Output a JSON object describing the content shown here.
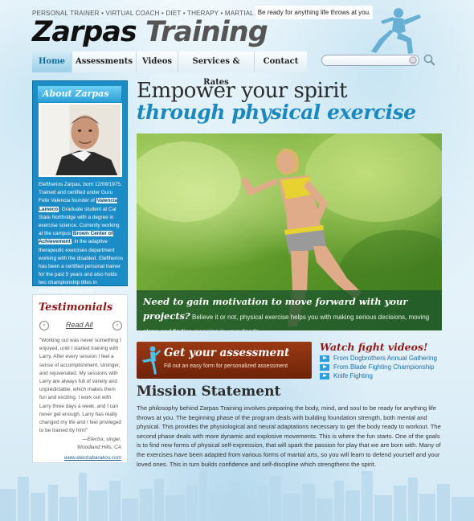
{
  "header": {
    "tagline": "PERSONAL TRAINER  •  VIRTUAL COACH  •  DIET  •  THERAPY  •  MARTIAL ARTS",
    "logo_part1": "Zarpas",
    "logo_part2": "Training",
    "slogan": "Be ready for anything life throws at you."
  },
  "nav": {
    "items": [
      {
        "label": "Home"
      },
      {
        "label": "Assessments"
      },
      {
        "label": "Videos"
      },
      {
        "label": "Services & Rates"
      },
      {
        "label": "Contact"
      }
    ]
  },
  "search": {
    "value": "",
    "clear_glyph": "⊗"
  },
  "about": {
    "title": "About Zarpas",
    "t1": "Eleftherios Zarpas, born 12/09/1975. Trained and certified under Guru Felix Valencia founder of ",
    "link1": "Valencia Lameco",
    "t2": ". Graduate student at Cal State Northridge with a degree in exercise science. Currently working at the campus ",
    "link2": "Brown Center of Achievement",
    "t3": ", in the adaptive therapeutic exercises department working with the disabled. Eleftherios has been a certified personal trainer for the past 5 years and also holds two championship titles in international martial arts tournaments."
  },
  "testimonials": {
    "title": "Testimonials",
    "prev": "‹",
    "next": "›",
    "read_all": "Read All",
    "quote": "\"Working out was never something I enjoyed, until I started training with Larry. After every session I feel a sense of accomplishment, stronger, and rejuvenated. My sessions with Larry are always full of variety and unpredictable, which makes them fun and exciting. I work out with Larry three days a week, and I can never get enough. Larry has really changed my life and I feel privileged to be trained by him!\"",
    "author_line1": "—Electra, singer,",
    "author_line2": "Woodland Hills, CA",
    "link": "www.electrabarakos.com"
  },
  "hero": {
    "headline1": "Empower your spirit",
    "headline2": "through physical exercise",
    "caption_lead": "Need to gain motivation to move forward with your projects?",
    "caption_body": " Believe it or not, physical exercise helps you with making serious decisions, moving along and finding meaning in your deeds."
  },
  "assessment": {
    "title": "Get your assessment",
    "subtitle": "Fill out an easy form for personalized assessment"
  },
  "videos": {
    "title": "Watch fight videos!",
    "items": [
      {
        "label": "From Dogbrothers Annual Gathering"
      },
      {
        "label": "From Blade Fighting Championship"
      },
      {
        "label": "Knife Fighting"
      }
    ]
  },
  "mission": {
    "title": "Mission Statement",
    "text": "The philosophy behind Zarpas Training involves preparing the body, mind, and soul to be ready for anything life throws at you. The beginning phase of the program deals with building foundation strength, both mental and physical. This provides the physiological and neural adaptations necessary to get the body ready to workout. The second phase deals with more dynamic and explosive movements. This is where the fun starts. One of the goals is to find new forms of physical self-expression, that will spark the passion for play that we are born with. Many of the exercises have been adapted from various forms of martial arts, so you will learn to defend yourself and your loved ones. This in turn builds confidence and self-discipline which strengthens the spirit."
  },
  "colors": {
    "accent_blue": "#1b89c0",
    "testimonial_red": "#8e1a1a",
    "assessment_brown": "#7a2a0d",
    "about_panel": "#1c8cc6"
  }
}
